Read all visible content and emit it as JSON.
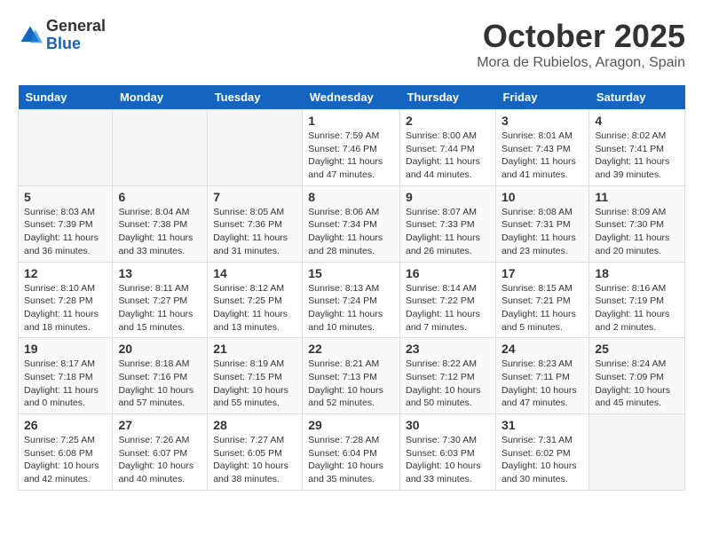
{
  "header": {
    "logo_general": "General",
    "logo_blue": "Blue",
    "month_title": "October 2025",
    "location": "Mora de Rubielos, Aragon, Spain"
  },
  "days_of_week": [
    "Sunday",
    "Monday",
    "Tuesday",
    "Wednesday",
    "Thursday",
    "Friday",
    "Saturday"
  ],
  "weeks": [
    [
      {
        "day": "",
        "info": ""
      },
      {
        "day": "",
        "info": ""
      },
      {
        "day": "",
        "info": ""
      },
      {
        "day": "1",
        "info": "Sunrise: 7:59 AM\nSunset: 7:46 PM\nDaylight: 11 hours and 47 minutes."
      },
      {
        "day": "2",
        "info": "Sunrise: 8:00 AM\nSunset: 7:44 PM\nDaylight: 11 hours and 44 minutes."
      },
      {
        "day": "3",
        "info": "Sunrise: 8:01 AM\nSunset: 7:43 PM\nDaylight: 11 hours and 41 minutes."
      },
      {
        "day": "4",
        "info": "Sunrise: 8:02 AM\nSunset: 7:41 PM\nDaylight: 11 hours and 39 minutes."
      }
    ],
    [
      {
        "day": "5",
        "info": "Sunrise: 8:03 AM\nSunset: 7:39 PM\nDaylight: 11 hours and 36 minutes."
      },
      {
        "day": "6",
        "info": "Sunrise: 8:04 AM\nSunset: 7:38 PM\nDaylight: 11 hours and 33 minutes."
      },
      {
        "day": "7",
        "info": "Sunrise: 8:05 AM\nSunset: 7:36 PM\nDaylight: 11 hours and 31 minutes."
      },
      {
        "day": "8",
        "info": "Sunrise: 8:06 AM\nSunset: 7:34 PM\nDaylight: 11 hours and 28 minutes."
      },
      {
        "day": "9",
        "info": "Sunrise: 8:07 AM\nSunset: 7:33 PM\nDaylight: 11 hours and 26 minutes."
      },
      {
        "day": "10",
        "info": "Sunrise: 8:08 AM\nSunset: 7:31 PM\nDaylight: 11 hours and 23 minutes."
      },
      {
        "day": "11",
        "info": "Sunrise: 8:09 AM\nSunset: 7:30 PM\nDaylight: 11 hours and 20 minutes."
      }
    ],
    [
      {
        "day": "12",
        "info": "Sunrise: 8:10 AM\nSunset: 7:28 PM\nDaylight: 11 hours and 18 minutes."
      },
      {
        "day": "13",
        "info": "Sunrise: 8:11 AM\nSunset: 7:27 PM\nDaylight: 11 hours and 15 minutes."
      },
      {
        "day": "14",
        "info": "Sunrise: 8:12 AM\nSunset: 7:25 PM\nDaylight: 11 hours and 13 minutes."
      },
      {
        "day": "15",
        "info": "Sunrise: 8:13 AM\nSunset: 7:24 PM\nDaylight: 11 hours and 10 minutes."
      },
      {
        "day": "16",
        "info": "Sunrise: 8:14 AM\nSunset: 7:22 PM\nDaylight: 11 hours and 7 minutes."
      },
      {
        "day": "17",
        "info": "Sunrise: 8:15 AM\nSunset: 7:21 PM\nDaylight: 11 hours and 5 minutes."
      },
      {
        "day": "18",
        "info": "Sunrise: 8:16 AM\nSunset: 7:19 PM\nDaylight: 11 hours and 2 minutes."
      }
    ],
    [
      {
        "day": "19",
        "info": "Sunrise: 8:17 AM\nSunset: 7:18 PM\nDaylight: 11 hours and 0 minutes."
      },
      {
        "day": "20",
        "info": "Sunrise: 8:18 AM\nSunset: 7:16 PM\nDaylight: 10 hours and 57 minutes."
      },
      {
        "day": "21",
        "info": "Sunrise: 8:19 AM\nSunset: 7:15 PM\nDaylight: 10 hours and 55 minutes."
      },
      {
        "day": "22",
        "info": "Sunrise: 8:21 AM\nSunset: 7:13 PM\nDaylight: 10 hours and 52 minutes."
      },
      {
        "day": "23",
        "info": "Sunrise: 8:22 AM\nSunset: 7:12 PM\nDaylight: 10 hours and 50 minutes."
      },
      {
        "day": "24",
        "info": "Sunrise: 8:23 AM\nSunset: 7:11 PM\nDaylight: 10 hours and 47 minutes."
      },
      {
        "day": "25",
        "info": "Sunrise: 8:24 AM\nSunset: 7:09 PM\nDaylight: 10 hours and 45 minutes."
      }
    ],
    [
      {
        "day": "26",
        "info": "Sunrise: 7:25 AM\nSunset: 6:08 PM\nDaylight: 10 hours and 42 minutes."
      },
      {
        "day": "27",
        "info": "Sunrise: 7:26 AM\nSunset: 6:07 PM\nDaylight: 10 hours and 40 minutes."
      },
      {
        "day": "28",
        "info": "Sunrise: 7:27 AM\nSunset: 6:05 PM\nDaylight: 10 hours and 38 minutes."
      },
      {
        "day": "29",
        "info": "Sunrise: 7:28 AM\nSunset: 6:04 PM\nDaylight: 10 hours and 35 minutes."
      },
      {
        "day": "30",
        "info": "Sunrise: 7:30 AM\nSunset: 6:03 PM\nDaylight: 10 hours and 33 minutes."
      },
      {
        "day": "31",
        "info": "Sunrise: 7:31 AM\nSunset: 6:02 PM\nDaylight: 10 hours and 30 minutes."
      },
      {
        "day": "",
        "info": ""
      }
    ]
  ]
}
